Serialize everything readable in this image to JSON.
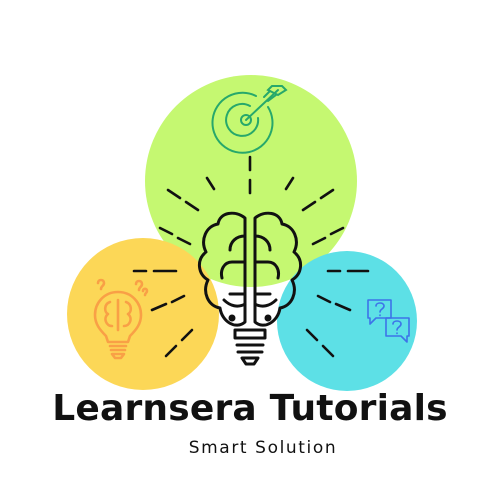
{
  "logo": {
    "brand_name": "Learnsera Tutorials",
    "tagline": "Smart Solution",
    "circles": {
      "green": "#c5f871",
      "yellow": "#fcd757",
      "cyan": "#5de0e6"
    },
    "accents": {
      "target_icon": "#27a86b",
      "bulb_icon": "#f9a046",
      "chat_icon": "#3d73e8",
      "ink": "#111111"
    },
    "icons": [
      "target-icon",
      "lightbulb-brain-icon",
      "question-chat-icon",
      "brain-bulb-icon"
    ]
  }
}
